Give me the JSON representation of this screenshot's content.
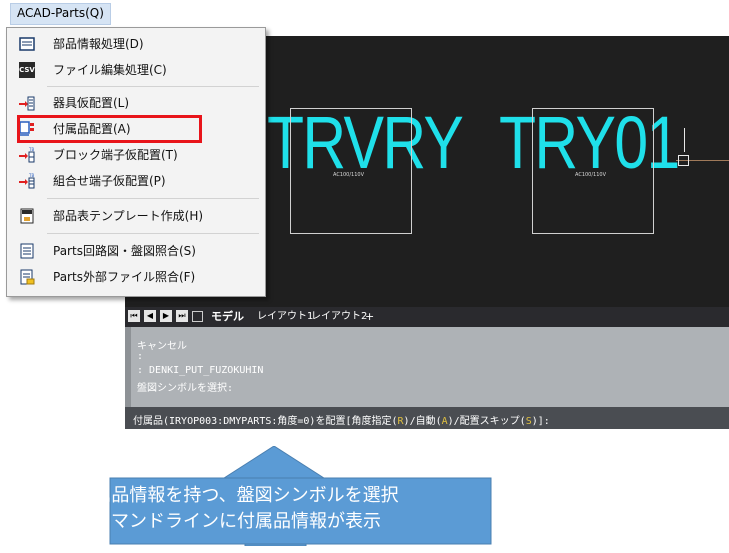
{
  "menu": {
    "title": "ACAD-Parts(Q)",
    "items": [
      {
        "label": "部品情報処理(D)",
        "icon": "parts-info-icon"
      },
      {
        "label": "ファイル編集処理(C)",
        "icon": "csv-icon"
      },
      {
        "label": "器具仮配置(L)",
        "icon": "device-place-icon"
      },
      {
        "label": "付属品配置(A)",
        "icon": "accessory-place-icon"
      },
      {
        "label": "ブロック端子仮配置(T)",
        "icon": "block-terminal-icon"
      },
      {
        "label": "組合せ端子仮配置(P)",
        "icon": "combo-terminal-icon"
      },
      {
        "label": "部品表テンプレート作成(H)",
        "icon": "parts-template-icon"
      },
      {
        "label": "Parts回路図・盤図照合(S)",
        "icon": "circuit-compare-icon"
      },
      {
        "label": "Parts外部ファイル照合(F)",
        "icon": "external-file-icon"
      }
    ],
    "csv_icon_text": "CSV"
  },
  "canvas": {
    "text1": "TRVRY",
    "text2": "TRY01",
    "box1_label": "AC100/110V",
    "box2_label": "AC100/110V"
  },
  "tabs": {
    "model": "モデル",
    "layout1": "レイアウト1",
    "layout2": "レイアウト2",
    "add": "+"
  },
  "command": {
    "history": [
      "キャンセル",
      ":",
      ": DENKI_PUT_FUZOKUHIN",
      "盤図シンボルを選択:"
    ],
    "prompt_main": "付属品(IRYOP003:DMYPARTS:角度=0)を配置[",
    "opt1": "角度指定(",
    "opt1_key": "R",
    "opt2": ")/自動(",
    "opt2_key": "A",
    "opt3": ")/配置スキップ(",
    "opt3_key": "S",
    "prompt_end": ")]:"
  },
  "callout": {
    "line1": "付属品情報を持つ、盤図シンボルを選択",
    "line2": "コマンドラインに付属品情報が表示"
  },
  "colors": {
    "accent_blue": "#5b9bd5",
    "highlight_red": "#e8141a",
    "cad_text": "#1fe0ea"
  }
}
